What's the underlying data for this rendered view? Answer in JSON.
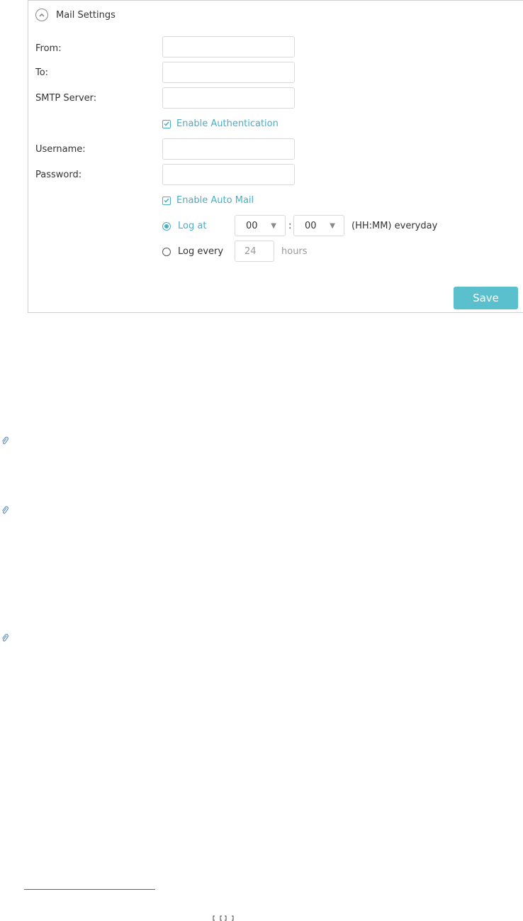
{
  "panel": {
    "title": "Mail Settings",
    "collapse_icon": "chevron-up-circle-icon"
  },
  "fields": {
    "from_label": "From:",
    "to_label": "To:",
    "smtp_label": "SMTP Server:",
    "username_label": "Username:",
    "password_label": "Password:",
    "from_value": "",
    "to_value": "",
    "smtp_value": "",
    "username_value": "",
    "password_value": ""
  },
  "options": {
    "enable_auth_label": "Enable Authentication",
    "enable_auth_checked": true,
    "enable_auto_mail_label": "Enable Auto Mail",
    "enable_auto_mail_checked": true
  },
  "schedule": {
    "log_at_label": "Log at",
    "log_at_selected": true,
    "hour_value": "00",
    "minute_value": "00",
    "colon": ":",
    "time_suffix": "(HH:MM) everyday",
    "log_every_label": "Log every",
    "log_every_selected": false,
    "hours_value": "24",
    "hours_label": "hours"
  },
  "actions": {
    "save_label": "Save"
  },
  "colors": {
    "accent": "#4bacc6",
    "save_button": "#5bc0ce"
  }
}
